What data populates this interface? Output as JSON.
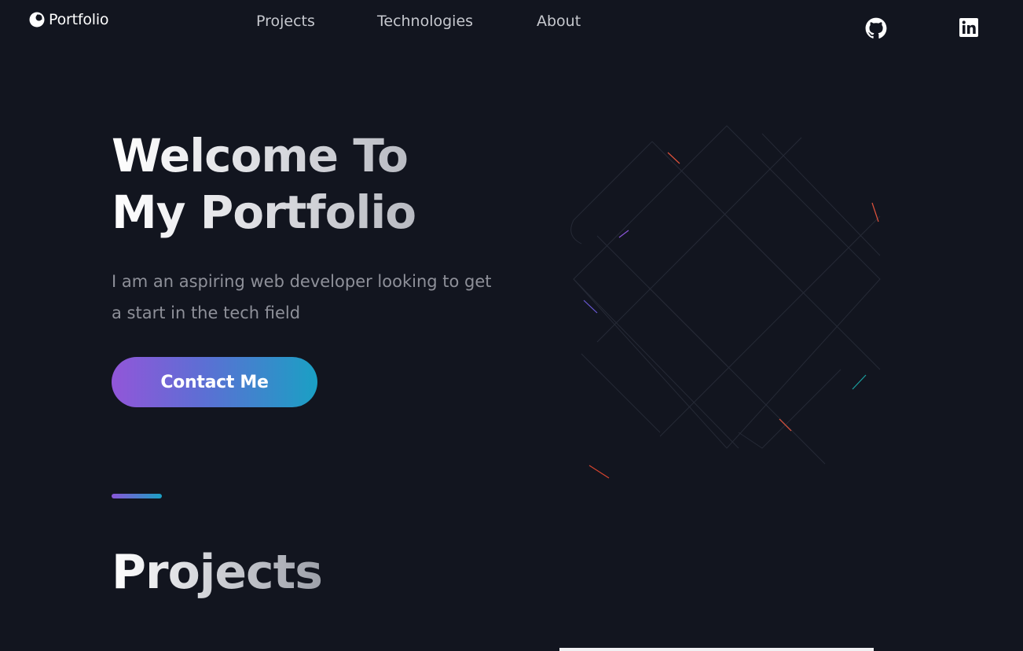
{
  "nav": {
    "logo_text": "Portfolio",
    "links": [
      "Projects",
      "Technologies",
      "About"
    ],
    "social": [
      "github-icon",
      "linkedin-icon"
    ]
  },
  "hero": {
    "title_line1": "Welcome To",
    "title_line2": "My Portfolio",
    "subtitle": "I am an aspiring web developer looking to get a start in the tech field",
    "button_label": "Contact Me"
  },
  "projects": {
    "title": "Projects"
  },
  "colors": {
    "background": "#12151f",
    "gradient_start": "#9256d9",
    "gradient_end": "#1aa0c4",
    "nav_text": "#c6c8ce",
    "muted_text": "#8e9099"
  }
}
